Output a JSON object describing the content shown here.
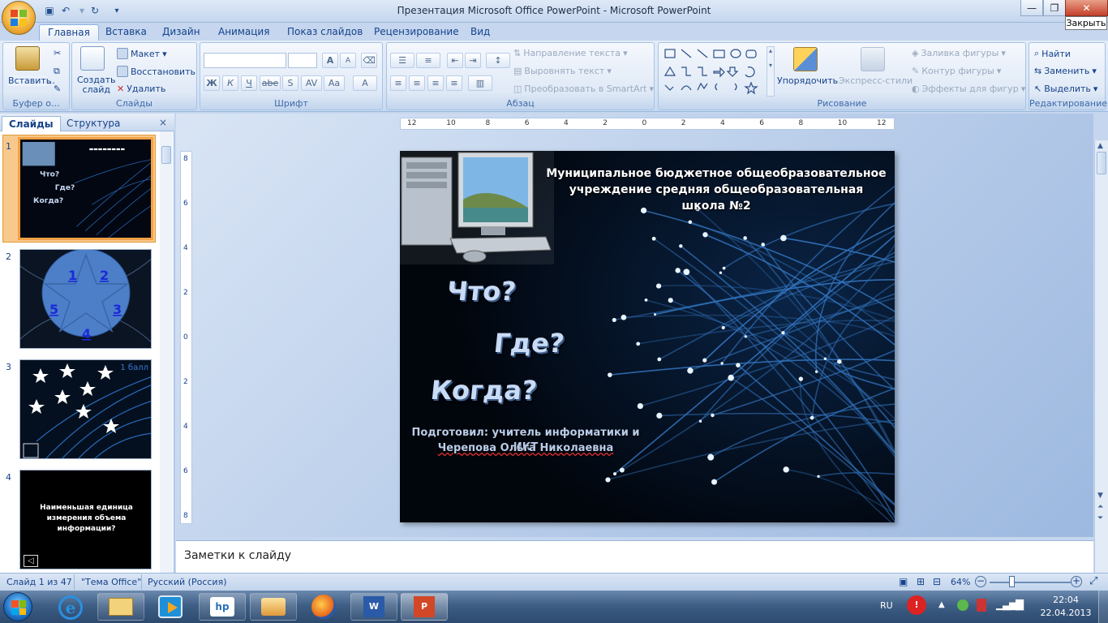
{
  "window": {
    "title": "Презентация Microsoft Office PowerPoint - Microsoft PowerPoint",
    "close_tooltip": "Закрыть"
  },
  "ribbon_tabs": [
    "Главная",
    "Вставка",
    "Дизайн",
    "Анимация",
    "Показ слайдов",
    "Рецензирование",
    "Вид"
  ],
  "groups": {
    "clipboard": {
      "label": "Буфер о...",
      "paste": "Вставить"
    },
    "slides": {
      "label": "Слайды",
      "new_slide": "Создать слайд",
      "layout": "Макет",
      "reset": "Восстановить",
      "delete": "Удалить"
    },
    "font": {
      "label": "Шрифт",
      "bold": "Ж",
      "italic": "К",
      "underline": "Ч",
      "strike": "abe",
      "shadow": "S",
      "spacing": "AV",
      "case": "Aa",
      "grow": "A",
      "shrink": "A",
      "color": "A"
    },
    "paragraph": {
      "label": "Абзац",
      "text_direction": "Направление текста",
      "align_text": "Выровнять текст",
      "smartart": "Преобразовать в SmartArt"
    },
    "drawing": {
      "label": "Рисование",
      "arrange": "Упорядочить",
      "quick_styles": "Экспресс-стили",
      "fill": "Заливка фигуры",
      "outline": "Контур фигуры",
      "effects": "Эффекты для фигур"
    },
    "editing": {
      "label": "Редактирование",
      "find": "Найти",
      "replace": "Заменить",
      "select": "Выделить"
    }
  },
  "panel_tabs": [
    "Слайды",
    "Структура"
  ],
  "thumbnails": [
    {
      "num": "1"
    },
    {
      "num": "2",
      "labels": [
        "1",
        "2",
        "3",
        "4",
        "5"
      ]
    },
    {
      "num": "3",
      "badge": "1 балл"
    },
    {
      "num": "4",
      "text": "Наименьшая единица измерения объема информации?"
    }
  ],
  "ruler_marks": [
    "12",
    "10",
    "8",
    "6",
    "4",
    "2",
    "0",
    "2",
    "4",
    "6",
    "8",
    "10",
    "12"
  ],
  "vruler_marks": [
    "8",
    "6",
    "4",
    "2",
    "0",
    "2",
    "4",
    "6",
    "8"
  ],
  "slide": {
    "school_line1": "Муниципальное бюджетное общеобразовательное",
    "school_line2": "учреждение средняя общеобразовательная школа №2",
    "q1": "Что?",
    "q2": "Где?",
    "q3": "Когда?",
    "author_line1": "Подготовил: учитель информатики и ИКТ",
    "author_line2": "Черепова Ольга Николаевна"
  },
  "notes_placeholder": "Заметки к слайду",
  "status": {
    "slide": "Слайд 1 из 47",
    "theme": "\"Тема Office\"",
    "language": "Русский (Россия)",
    "zoom": "64%"
  },
  "tray": {
    "lang": "RU",
    "time": "22:04",
    "date": "22.04.2013"
  }
}
